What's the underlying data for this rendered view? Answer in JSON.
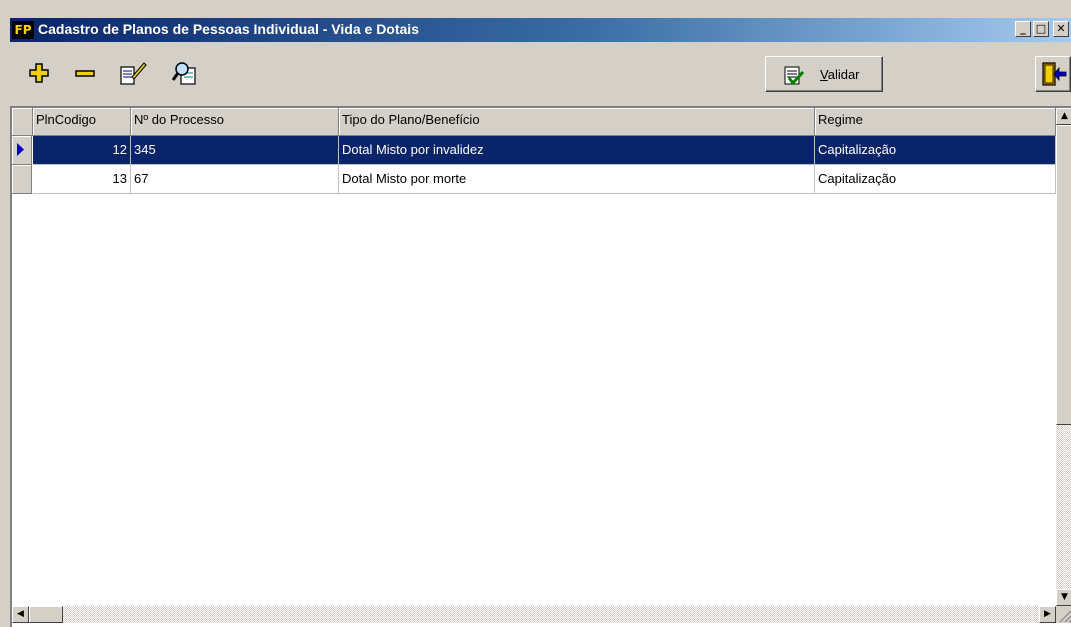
{
  "window": {
    "title": "Cadastro de Planos de Pessoas Individual - Vida e Dotais",
    "app_icon_text": "FP",
    "minimize_glyph": "_",
    "maximize_glyph": "□",
    "close_glyph": "✕"
  },
  "toolbar": {
    "add_icon": "plus-icon",
    "remove_icon": "minus-icon",
    "edit_icon": "edit-document-icon",
    "search_icon": "search-icon",
    "validar_label": "Validar",
    "validar_icon": "checklist-icon",
    "exit_icon": "exit-door-icon"
  },
  "grid": {
    "columns": [
      "PlnCodigo",
      "Nº do Processo",
      "Tipo do Plano/Benefício",
      "Regime"
    ],
    "rows": [
      {
        "codigo": "12",
        "processo": "345",
        "tipo": "Dotal Misto por invalidez",
        "regime": "Capitalização",
        "selected": true
      },
      {
        "codigo": "13",
        "processo": "67",
        "tipo": "Dotal Misto por morte",
        "regime": "Capitalização",
        "selected": false
      }
    ]
  },
  "colors": {
    "selection": "#0a246a",
    "window_bg": "#d4d0c8",
    "icon_yellow": "#e8c000"
  }
}
